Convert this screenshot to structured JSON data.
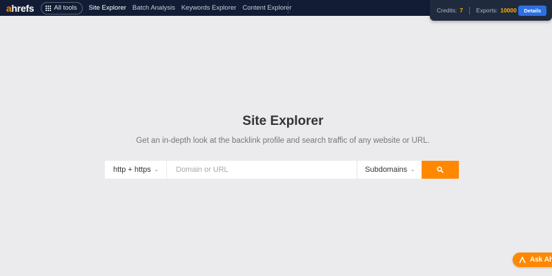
{
  "logo": {
    "first_letter": "a",
    "rest": "hrefs"
  },
  "nav": {
    "all_tools_label": "All tools",
    "links": [
      "Site Explorer",
      "Batch Analysis",
      "Keywords Explorer",
      "Content Explorer"
    ]
  },
  "credits_panel": {
    "credits_label": "Credits:",
    "credits_value": "7",
    "exports_label": "Exports:",
    "exports_value": "10000",
    "details_label": "Details"
  },
  "hero": {
    "title": "Site Explorer",
    "subtitle": "Get an in-depth look at the backlink profile and search traffic of any website or URL."
  },
  "search": {
    "protocol_value": "http + https",
    "placeholder": "Domain or URL",
    "mode_value": "Subdomains"
  },
  "ask_button": {
    "label": "Ask Ahr"
  },
  "colors": {
    "nav_bg": "#121d35",
    "accent": "#ff8800",
    "details_button": "#2d6fe0",
    "page_bg": "#ebebee"
  },
  "icons": {
    "all_tools": "grid-icon",
    "search": "search-icon",
    "dropdown": "chevron-down-icon",
    "ask": "ahrefs-a-icon"
  }
}
